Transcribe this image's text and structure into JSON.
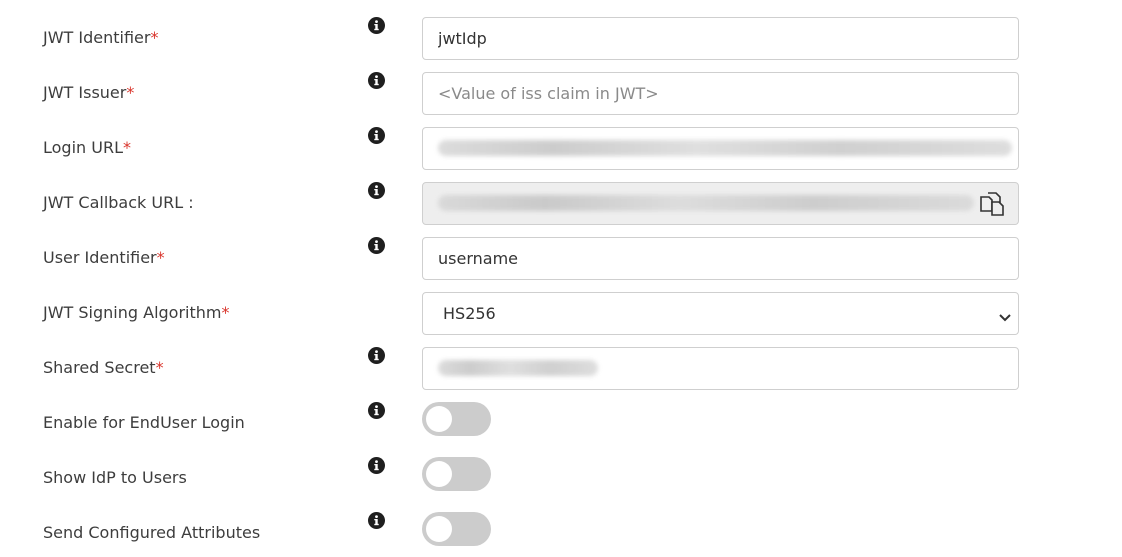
{
  "fields": {
    "jwt_identifier": {
      "label": "JWT Identifier",
      "value": "jwtIdp"
    },
    "jwt_issuer": {
      "label": "JWT Issuer",
      "placeholder": "<Value of iss claim in JWT>"
    },
    "login_url": {
      "label": "Login URL",
      "value": ""
    },
    "jwt_callback_url": {
      "label": "JWT Callback URL :",
      "value": ""
    },
    "user_identifier": {
      "label": "User Identifier",
      "value": "username"
    },
    "signing_algorithm": {
      "label": "JWT Signing Algorithm",
      "selected": "HS256"
    },
    "shared_secret": {
      "label": "Shared Secret",
      "value": ""
    },
    "enable_enduser_login": {
      "label": "Enable for EndUser Login",
      "enabled": false
    },
    "show_idp_to_users": {
      "label": "Show IdP to Users",
      "enabled": false
    },
    "send_configured_attributes": {
      "label": "Send Configured Attributes",
      "enabled": false
    }
  },
  "required_marker": "*",
  "icons": {
    "info": "info-icon",
    "copy": "copy-icon",
    "dropdown": "chevron-down-icon"
  },
  "colors": {
    "required": "#d9342b",
    "toggle_off": "#cccccc",
    "disabled_field": "#eeeeee"
  }
}
